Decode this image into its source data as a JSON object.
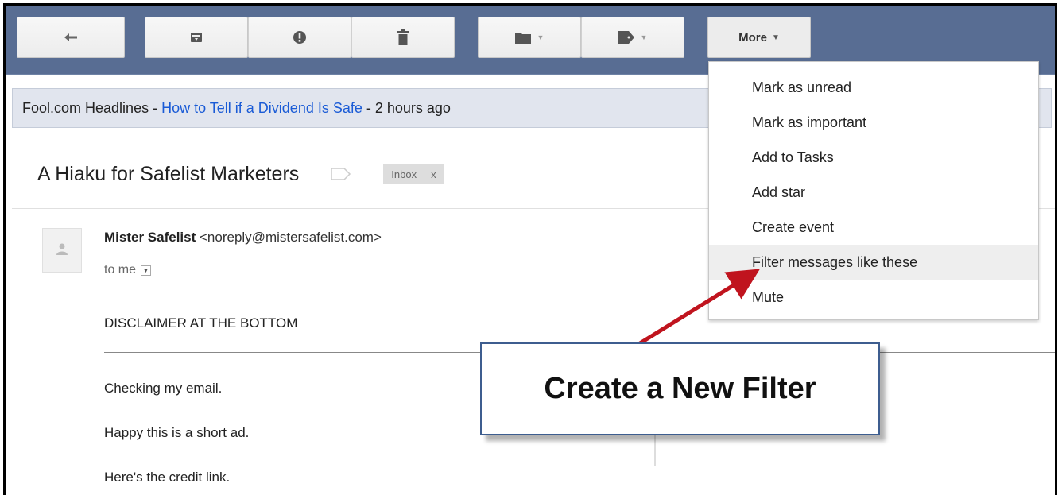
{
  "toolbar": {
    "buttons": [
      {
        "name": "back",
        "icon": "back-arrow-icon"
      },
      {
        "name": "archive",
        "icon": "archive-icon"
      },
      {
        "name": "report-spam",
        "icon": "report-spam-icon"
      },
      {
        "name": "delete",
        "icon": "trash-icon"
      },
      {
        "name": "move-to",
        "icon": "folder-icon"
      },
      {
        "name": "labels",
        "icon": "label-tag-icon"
      }
    ],
    "more_label": "More",
    "background_color": "#586d93"
  },
  "headline": {
    "prefix": "Fool.com Headlines - ",
    "link_text": "How to Tell if a Dividend Is Safe",
    "suffix": " - 2 hours ago",
    "link_color": "#1a5bd6"
  },
  "message": {
    "subject": "A Hiaku for Safelist Marketers",
    "inbox_chip": "Inbox",
    "inbox_chip_close": "x",
    "sender_name": "Mister Safelist",
    "sender_email": "<noreply@mistersafelist.com>",
    "recipient": "to me",
    "body": {
      "disclaimer": "DISCLAIMER AT THE BOTTOM",
      "line1": "Checking my email.",
      "line2": "Happy this is a short ad.",
      "line3": "Here's the credit link."
    }
  },
  "more_menu": {
    "items": [
      {
        "label": "Mark as unread"
      },
      {
        "label": "Mark as important"
      },
      {
        "label": "Add to Tasks"
      },
      {
        "label": "Add star"
      },
      {
        "label": "Create event"
      },
      {
        "label": "Filter messages like these",
        "highlighted": true
      },
      {
        "label": "Mute"
      }
    ]
  },
  "callout": {
    "text": "Create a New Filter",
    "arrow_color": "#c0141e",
    "border_color": "#3d5d8f"
  }
}
